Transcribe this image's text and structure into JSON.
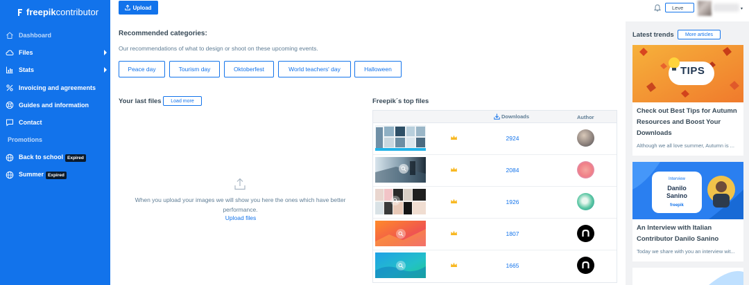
{
  "brand": {
    "name_bold": "freepik",
    "name_light": "contributor",
    "accent": "#1273eb"
  },
  "sidebar": {
    "items": [
      {
        "label": "Dashboard",
        "icon": "home-icon"
      },
      {
        "label": "Files",
        "icon": "cloud-icon",
        "has_submenu": true
      },
      {
        "label": "Stats",
        "icon": "bar-chart-icon",
        "has_submenu": true
      },
      {
        "label": "Invoicing and agreements",
        "icon": "percent-icon"
      },
      {
        "label": "Guides and information",
        "icon": "lifebuoy-icon"
      },
      {
        "label": "Contact",
        "icon": "chat-icon"
      }
    ],
    "promotions_heading": "Promotions",
    "promotions": [
      {
        "label": "Back to school",
        "badge": "Expired",
        "icon": "globe-icon"
      },
      {
        "label": "Summer",
        "badge": "Expired",
        "icon": "globe-icon"
      }
    ]
  },
  "topbar": {
    "upload_label": "Upload",
    "level_label": "Leve"
  },
  "recommended": {
    "title": "Recommended categories:",
    "subtitle": "Our recommendations of what to design or shoot on these upcoming events.",
    "categories": [
      "Peace day",
      "Tourism day",
      "Oktoberfest",
      "World teachers' day",
      "Halloween"
    ]
  },
  "last_files": {
    "title": "Your last files",
    "load_more": "Load more",
    "empty_message": "When you upload your images we will show you here the ones which have better performance.",
    "upload_link": "Upload files"
  },
  "top_files": {
    "title": "Freepik´s top files",
    "downloads_header": "Downloads",
    "author_header": "Author",
    "rows": [
      {
        "downloads": "2924"
      },
      {
        "downloads": "2084"
      },
      {
        "downloads": "1926"
      },
      {
        "downloads": "1807"
      },
      {
        "downloads": "1665"
      }
    ]
  },
  "trends": {
    "title": "Latest trends",
    "more_label": "More articles",
    "articles": [
      {
        "image_text": "TIPS",
        "title": "Check out Best Tips for Autumn Resources and Boost Your Downloads",
        "excerpt": "Although we all love summer, Autumn is ..."
      },
      {
        "image_kicker": "Interview",
        "image_text": "Danilo Sanino",
        "image_brand": "freepik",
        "title": "An Interview with Italian Contributor Danilo Sanino",
        "excerpt": "Today we share with you an interview wit..."
      }
    ]
  }
}
